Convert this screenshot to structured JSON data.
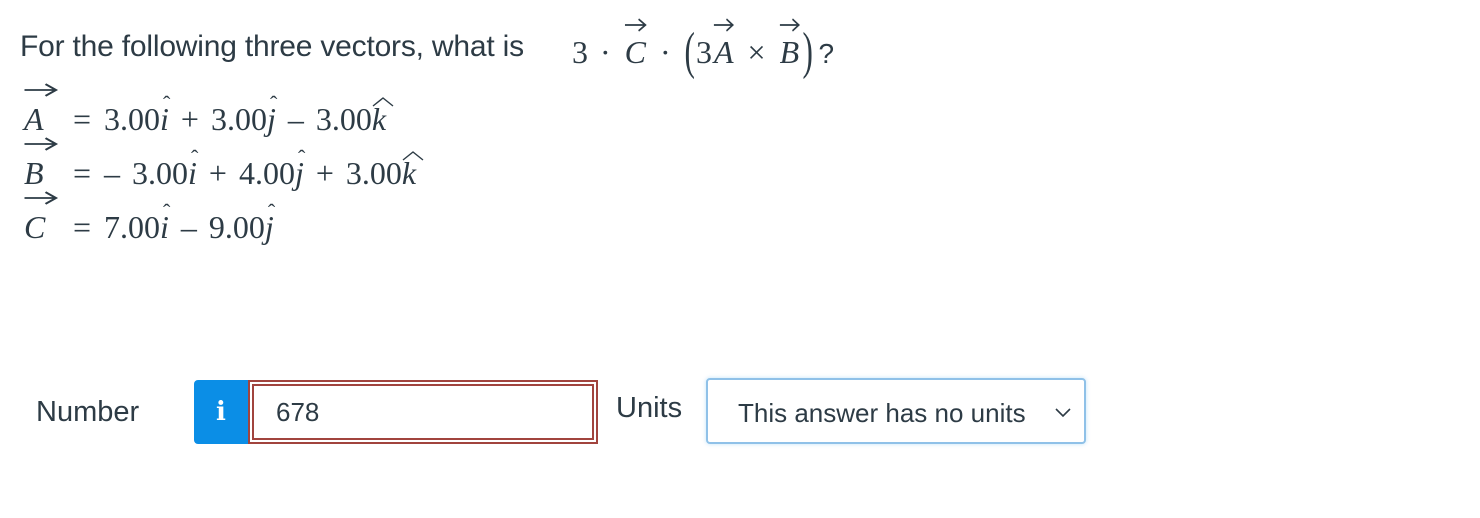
{
  "question": {
    "prompt": "For the following three vectors, what is",
    "expression": {
      "scalar": "3",
      "dot": "·",
      "vec_c": "C",
      "inner_scalar": "3",
      "vec_a": "A",
      "cross": "×",
      "vec_b": "B",
      "open_paren": "(",
      "close_paren": ")",
      "question_mark": "?"
    },
    "vectors": [
      {
        "name": "A",
        "equals": "=",
        "terms": [
          {
            "sign": "",
            "coef": "3.00",
            "unit": "i"
          },
          {
            "sign": "+",
            "coef": "3.00",
            "unit": "j"
          },
          {
            "sign": "–",
            "coef": "3.00",
            "unit": "k"
          }
        ]
      },
      {
        "name": "B",
        "equals": "=",
        "terms": [
          {
            "sign": "–",
            "coef": "3.00",
            "unit": "i"
          },
          {
            "sign": "+",
            "coef": "4.00",
            "unit": "j"
          },
          {
            "sign": "+",
            "coef": "3.00",
            "unit": "k"
          }
        ]
      },
      {
        "name": "C",
        "equals": "=",
        "terms": [
          {
            "sign": "",
            "coef": "7.00",
            "unit": "i"
          },
          {
            "sign": "–",
            "coef": "9.00",
            "unit": "j"
          }
        ]
      }
    ]
  },
  "answer": {
    "number_label": "Number",
    "info_icon": "info-icon",
    "info_glyph": "i",
    "number_value": "678",
    "units_label": "Units",
    "units_selected": "This answer has no units",
    "units_icon": "chevron-down-icon"
  },
  "colors": {
    "text": "#2d3b45",
    "info_button": "#0b8ee6",
    "error_border": "#a1443e",
    "select_border": "#8fc1e8"
  }
}
